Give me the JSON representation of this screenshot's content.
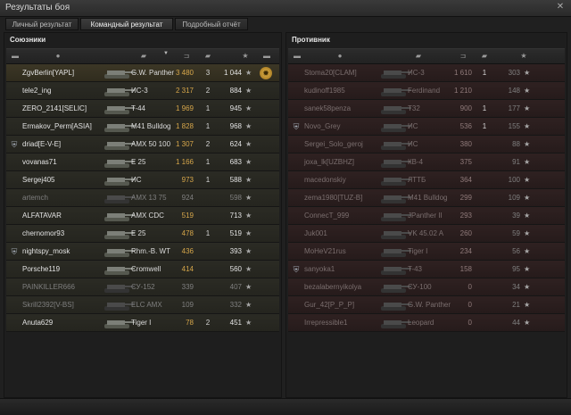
{
  "window": {
    "title": "Результаты боя",
    "close_icon": "close-icon"
  },
  "tabs": [
    {
      "label": "Личный результат",
      "active": false
    },
    {
      "label": "Командный результат",
      "active": true
    },
    {
      "label": "Подробный отчёт",
      "active": false
    }
  ],
  "allies": {
    "title": "Союзники",
    "rows": [
      {
        "name": "ZgvBerlin[YAPL]",
        "tank": "G.W. Panther",
        "damage": "3 480",
        "kills": "3",
        "xp": "1 044",
        "state": "me",
        "clan_icon": false,
        "medal": true
      },
      {
        "name": "tele2_ing",
        "tank": "ИС-3",
        "damage": "2 317",
        "kills": "2",
        "xp": "884",
        "state": "alive"
      },
      {
        "name": "ZERO_2141[SELIC]",
        "tank": "T-44",
        "damage": "1 969",
        "kills": "1",
        "xp": "945",
        "state": "alive"
      },
      {
        "name": "Ermakov_Perm[ASIA]",
        "tank": "M41 Bulldog",
        "damage": "1 828",
        "kills": "1",
        "xp": "968",
        "state": "alive"
      },
      {
        "name": "driad[E-V-E]",
        "tank": "AMX 50 100",
        "damage": "1 307",
        "kills": "2",
        "xp": "624",
        "state": "alive",
        "clan_icon": true
      },
      {
        "name": "vovanas71",
        "tank": "E 25",
        "damage": "1 166",
        "kills": "1",
        "xp": "683",
        "state": "alive"
      },
      {
        "name": "Sergej405",
        "tank": "ИС",
        "damage": "973",
        "kills": "1",
        "xp": "588",
        "state": "alive"
      },
      {
        "name": "artemch",
        "tank": "AMX 13 75",
        "damage": "924",
        "kills": "",
        "xp": "598",
        "state": "dead"
      },
      {
        "name": "ALFATAVAR",
        "tank": "AMX CDC",
        "damage": "519",
        "kills": "",
        "xp": "713",
        "state": "alive"
      },
      {
        "name": "chernomor93",
        "tank": "E 25",
        "damage": "478",
        "kills": "1",
        "xp": "519",
        "state": "alive"
      },
      {
        "name": "nightspy_mosk",
        "tank": "Rhm.-B. WT",
        "damage": "436",
        "kills": "",
        "xp": "393",
        "state": "alive",
        "clan_icon": true
      },
      {
        "name": "Porsche119",
        "tank": "Cromwell",
        "damage": "414",
        "kills": "",
        "xp": "560",
        "state": "alive"
      },
      {
        "name": "PAINKILLER666",
        "tank": "СУ-152",
        "damage": "339",
        "kills": "",
        "xp": "407",
        "state": "dead"
      },
      {
        "name": "Skrill2392[V-BS]",
        "tank": "ELC AMX",
        "damage": "109",
        "kills": "",
        "xp": "332",
        "state": "dead"
      },
      {
        "name": "Anuta629",
        "tank": "Tiger I",
        "damage": "78",
        "kills": "2",
        "xp": "451",
        "state": "alive"
      }
    ]
  },
  "enemies": {
    "title": "Противник",
    "rows": [
      {
        "name": "Stoma20[CLAM]",
        "tank": "ИС-3",
        "damage": "1 610",
        "kills": "1",
        "xp": "303",
        "state": "dead"
      },
      {
        "name": "kudinoff1985",
        "tank": "Ferdinand",
        "damage": "1 210",
        "kills": "",
        "xp": "148",
        "state": "dead"
      },
      {
        "name": "sanek58penza",
        "tank": "T32",
        "damage": "900",
        "kills": "1",
        "xp": "177",
        "state": "dead"
      },
      {
        "name": "Novo_Grey",
        "tank": "ИС",
        "damage": "536",
        "kills": "1",
        "xp": "155",
        "state": "dead",
        "clan_icon": true
      },
      {
        "name": "Sergei_Solo_geroj",
        "tank": "ИС",
        "damage": "380",
        "kills": "",
        "xp": "88",
        "state": "dead"
      },
      {
        "name": "joxa_lk[UZBHZ]",
        "tank": "КВ-4",
        "damage": "375",
        "kills": "",
        "xp": "91",
        "state": "dead"
      },
      {
        "name": "macedonskiy",
        "tank": "ЛТТБ",
        "damage": "364",
        "kills": "",
        "xp": "100",
        "state": "dead"
      },
      {
        "name": "zema1980[TUZ-B]",
        "tank": "M41 Bulldog",
        "damage": "299",
        "kills": "",
        "xp": "109",
        "state": "dead"
      },
      {
        "name": "ConnecT_999",
        "tank": "JPanther II",
        "damage": "293",
        "kills": "",
        "xp": "39",
        "state": "dead"
      },
      {
        "name": "Juk001",
        "tank": "VK 45.02 A",
        "damage": "260",
        "kills": "",
        "xp": "59",
        "state": "dead"
      },
      {
        "name": "MoHeV21rus",
        "tank": "Tiger I",
        "damage": "234",
        "kills": "",
        "xp": "56",
        "state": "dead"
      },
      {
        "name": "sanyoka1",
        "tank": "T-43",
        "damage": "158",
        "kills": "",
        "xp": "95",
        "state": "dead",
        "clan_icon": true
      },
      {
        "name": "bezalabernyikolya",
        "tank": "СУ-100",
        "damage": "0",
        "kills": "",
        "xp": "34",
        "state": "dead"
      },
      {
        "name": "Gur_42[P_P_P]",
        "tank": "G.W. Panther",
        "damage": "0",
        "kills": "",
        "xp": "21",
        "state": "dead"
      },
      {
        "name": "Irrepressible1",
        "tank": "Leopard",
        "damage": "0",
        "kills": "",
        "xp": "44",
        "state": "dead"
      }
    ]
  }
}
